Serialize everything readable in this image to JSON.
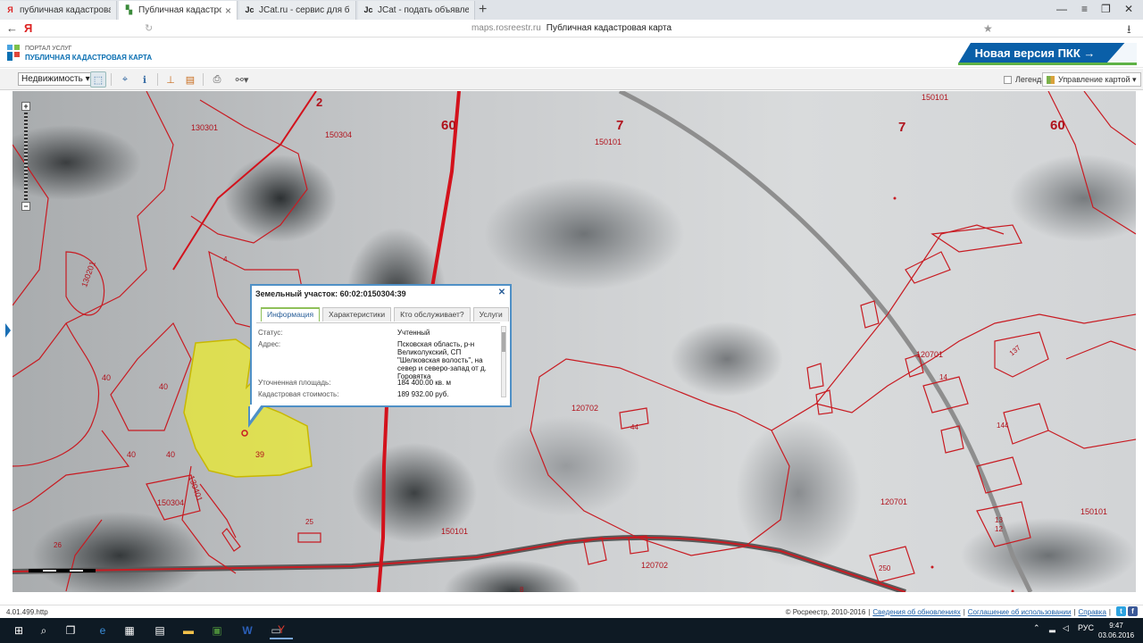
{
  "browser": {
    "tabs": [
      {
        "label": "публичная кадастровая карт",
        "icon": "yandex-icon"
      },
      {
        "label": "Публичная кадастровая",
        "icon": "pkk-icon"
      },
      {
        "label": "JCat.ru - сервис для быстрой",
        "icon": "jcat-icon"
      },
      {
        "label": "JCat - подать объявление, ра",
        "icon": "jcat-icon"
      }
    ],
    "new_tab": "+",
    "address_domain": "maps.rosreestr.ru",
    "address_title": "Публичная кадастровая карта",
    "yandex_letter": "Я"
  },
  "header": {
    "logo_top": "ПОРТАЛ УСЛУГ",
    "logo_bottom": "ПУБЛИЧНАЯ КАДАСТРОВАЯ КАРТА",
    "new_version": "Новая версия ПКК →"
  },
  "toolbar": {
    "layer_select": "Недвижимость",
    "legend_label": "Легенда",
    "map_control_label": "Управление картой"
  },
  "map": {
    "labels": [
      {
        "text": "60",
        "big": true
      },
      {
        "text": "7",
        "big": true
      },
      {
        "text": "7",
        "big": true
      },
      {
        "text": "60",
        "big": true
      },
      {
        "text": "2",
        "big": true
      },
      {
        "text": "150101"
      },
      {
        "text": "150304"
      },
      {
        "text": "130301"
      },
      {
        "text": "130201"
      },
      {
        "text": "150101"
      },
      {
        "text": "120701"
      },
      {
        "text": "120702"
      },
      {
        "text": "120701"
      },
      {
        "text": "150101"
      },
      {
        "text": "150101"
      },
      {
        "text": "120702"
      },
      {
        "text": "150304"
      },
      {
        "text": "130401"
      },
      {
        "text": "40"
      },
      {
        "text": "40"
      },
      {
        "text": "40"
      },
      {
        "text": "40"
      },
      {
        "text": "39"
      },
      {
        "text": "44"
      },
      {
        "text": "25"
      },
      {
        "text": "26"
      },
      {
        "text": "144"
      },
      {
        "text": "137"
      },
      {
        "text": "250"
      },
      {
        "text": "13"
      },
      {
        "text": "12"
      },
      {
        "text": "14"
      },
      {
        "text": "4"
      },
      {
        "text": "8"
      }
    ]
  },
  "popup": {
    "title": "Земельный участок: 60:02:0150304:39",
    "tabs": [
      "Информация",
      "Характеристики",
      "Кто обслуживает?",
      "Услуги"
    ],
    "rows": [
      {
        "label": "Статус:",
        "value": "Учтенный"
      },
      {
        "label": "Адрес:",
        "value": "Псковская область, р-н Великолукский, СП \"Шелковская волость\", на север и северо-запад от д. Горовятка"
      },
      {
        "label": "Уточненная площадь:",
        "value": "184 400.00 кв. м"
      },
      {
        "label": "Кадастровая стоимость:",
        "value": "189 932.00 руб."
      }
    ]
  },
  "status": {
    "version": "4.01.499.http",
    "copyright": "© Росреестр, 2010-2016",
    "links": [
      "Сведения об обновлениях",
      "Соглашение об использовании",
      "Справка"
    ]
  },
  "taskbar": {
    "lang": "РУС",
    "time": "9:47",
    "date": "03.06.2016"
  }
}
